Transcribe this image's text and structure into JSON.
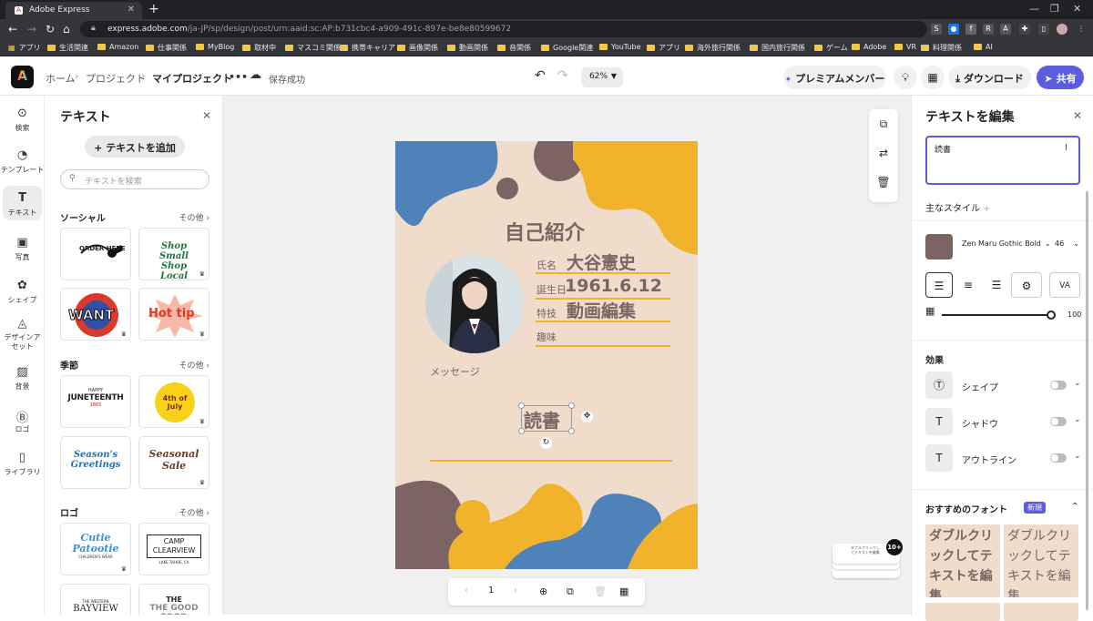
{
  "browser": {
    "tab_title": "Adobe Express",
    "url_host": "express.adobe.com",
    "url_path": "/ja-JP/sp/design/post/urn:aaid:sc:AP:b731cbc4-a909-491c-897e-be8e80599672",
    "bookmarks": [
      "アプリ",
      "生活関連",
      "Amazon",
      "仕事関係",
      "MyBlog",
      "取材中",
      "マスコミ関係",
      "携帯キャリア",
      "画像関係",
      "動画関係",
      "音関係",
      "Google関連",
      "YouTube",
      "アプリ",
      "海外旅行関係",
      "国内旅行関係",
      "ゲーム",
      "Adobe",
      "VR",
      "料理関係",
      "AI"
    ]
  },
  "header": {
    "logo": "A",
    "breadcrumb": [
      "ホーム",
      "プロジェクト",
      "マイプロジェクト"
    ],
    "more": "•••",
    "save_status": "保存成功",
    "zoom": "62%",
    "premium_label": "プレミアムメンバー",
    "download_label": "ダウンロード",
    "share_label": "共有"
  },
  "rail": [
    {
      "label": "検索",
      "icon": "search-icon"
    },
    {
      "label": "テンプレート",
      "icon": "template-icon"
    },
    {
      "label": "テキスト",
      "icon": "text-icon"
    },
    {
      "label": "写真",
      "icon": "photo-icon"
    },
    {
      "label": "シェイプ",
      "icon": "shape-icon"
    },
    {
      "label": "デザインアセット",
      "icon": "design-asset-icon"
    },
    {
      "label": "背景",
      "icon": "background-icon"
    },
    {
      "label": "ロゴ",
      "icon": "logo-icon"
    },
    {
      "label": "ライブラリ",
      "icon": "library-icon"
    }
  ],
  "text_panel": {
    "title": "テキスト",
    "add_button": "テキストを追加",
    "search_placeholder": "テキストを検索",
    "sections": [
      {
        "title": "ソーシャル",
        "more": "その他",
        "cards": [
          "ORDER HERE",
          "Shop Small Shop Local",
          "WANT",
          "Hot tip"
        ]
      },
      {
        "title": "季節",
        "more": "その他",
        "cards": [
          "JUNETEENTH",
          "4th of July",
          "Season's Greetings",
          "Seasonal Sale"
        ]
      },
      {
        "title": "ロゴ",
        "more": "その他",
        "cards": [
          "Cutie Patootie",
          "CAMP CLEARVIEW",
          "BAYVIEW",
          "THE GOOD FOOD"
        ]
      }
    ],
    "card_sublabels": {
      "happy": "HAPPY",
      "juneteenth_year": "1865",
      "children": "CHILDREN'S WEAR",
      "camp_place": "LAKE TAHOE, CA",
      "western": "THE WESTERN",
      "bayview_top": "THE"
    }
  },
  "design": {
    "title": "自己紹介",
    "fields": [
      {
        "label": "氏名",
        "value": "大谷憲史"
      },
      {
        "label": "誕生日",
        "value": "1961.6.12"
      },
      {
        "label": "特技",
        "value": "動画編集"
      },
      {
        "label": "趣味",
        "value": "読書"
      }
    ],
    "message_label": "メッセージ",
    "colors": {
      "bg": "#efdccb",
      "blue": "#4f82b8",
      "yellow": "#f0b32b",
      "brown": "#7b6463"
    }
  },
  "page_nav": {
    "page": "1"
  },
  "page_stack_badge": "10+",
  "page_stack_thumb": "ダブルクリックしてテキストを編集",
  "edit_panel": {
    "title": "テキストを編集",
    "text_value": "読書",
    "main_style_label": "主なスタイル",
    "font_name": "Zen Maru Gothic Bold",
    "font_size": "46",
    "opacity": "100%",
    "effects_label": "効果",
    "effects": [
      "シェイプ",
      "シャドウ",
      "アウトライン"
    ],
    "recommended_label": "おすすめのフォント",
    "new_badge": "新規",
    "font_sample": "ダブルクリックしてテキストを編集"
  }
}
